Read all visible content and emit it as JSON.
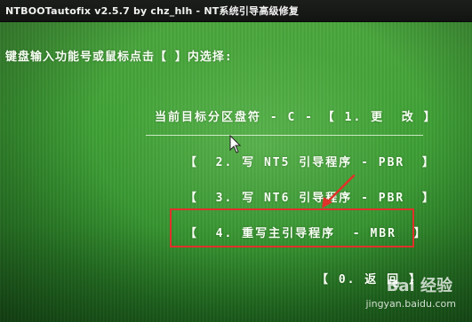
{
  "window": {
    "title": "NTBOOTautofix v2.5.7 by chz_hlh - NT系统引导高级修复"
  },
  "prompt": "键盘输入功能号或鼠标点击【 】内选择:",
  "current_drive": "当前目标分区盘符 - C - 【 1. 更  改 】",
  "menu": {
    "option2": "【  2. 写 NT5 引导程序 - PBR  】",
    "option3": "【  3. 写 NT6 引导程序 - PBR  】",
    "option4": "【  4. 重写主引导程序  - MBR  】",
    "option0": "【 0. 返 回 】"
  },
  "watermark": {
    "logo_text": "Bai  经验",
    "url": "jingyan.baidu.com"
  },
  "colors": {
    "highlight_box": "#e0312a",
    "screen_green": "#3b9f33",
    "text": "#f7fff3"
  },
  "icons": {
    "cursor": "mouse-pointer-icon",
    "annotation": "red-arrow-annotation",
    "watermark_logo": "paw-icon"
  }
}
